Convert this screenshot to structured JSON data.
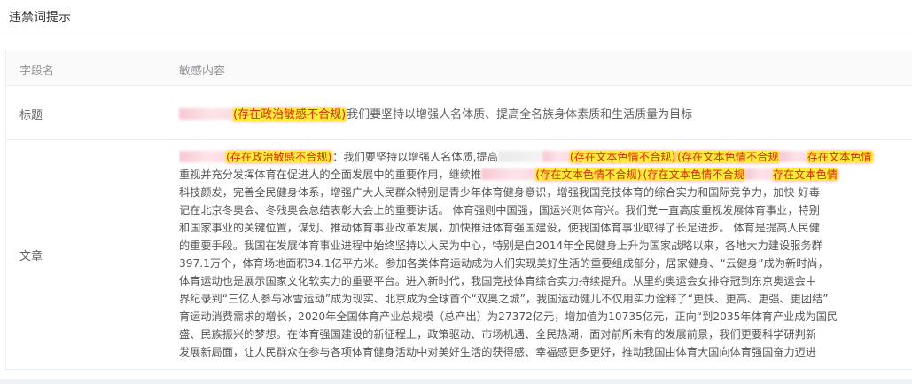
{
  "header": {
    "title": "违禁词提示"
  },
  "table": {
    "col_field": "字段名",
    "col_content": "敏感内容",
    "row_title": {
      "field": "标题",
      "flag": "(存在政治敏感不合规)",
      "text": "我们要坚持以增强人名体质、提高全名族身体素质和生活质量为目标"
    },
    "row_article": {
      "field": "文章",
      "line1_flag": "(存在政治敏感不合规)",
      "line1_text": "：我们要坚持以增强人名体质,提高",
      "line1_flag2": "(存在文本色情不合规)",
      "line1_flag3": "(存在文本色情不合规",
      "line1_flag4": "存在文本色情",
      "line2_text": "重视并充分发挥体育在促进人的全面发展中的重要作用，继续推",
      "line2_flag1": "(存在文本色情不合规)",
      "line2_flag2": "(存在文本色情不合规",
      "line2_flag3": "存在文本色情",
      "line3": "科技颜发，完善全民健身体系，增强广大人民群众特别是青少年体育健身意识，增强我国竞技体育的综合实力和国际竞争力，加快  好毒",
      "line4": "记在北京冬奥会、冬残奥会总结表彰大会上的重要讲话。 体育强则中国强，国运兴则体育兴。我们党一直高度重视发展体育事业，特别",
      "line5": "和国家事业的关键位置，谋划、推动体育事业改革发展，加快推进体育强国建设，使我国体育事业取得了长足进步。 体育是提高人民健",
      "line6": "的重要手段。我国在发展体育事业进程中始终坚持以人民为中心，特别是自2014年全民健身上升为国家战略以来，各地大力建设服务群",
      "line7": "397.1万个，体育场地面积34.1亿平方米。参加各类体育运动成为人们实现美好生活的重要组成部分，居家健身、“云健身”成为新时尚，",
      "line8": "体育运动也是展示国家文化软实力的重要平台。进入新时代，我国竞技体育综合实力持续提升。从里约奥运会女排夺冠到东京奥运会中",
      "line9": "界纪录到“三亿人参与冰雪运动”成为现实、北京成为全球首个“双奥之城”，我国运动健儿不仅用实力诠释了“更快、更高、更强、更团结”",
      "line10": "育运动消费需求的增长，2020年全国体育产业总规模（总产出）为27372亿元，增加值为10735亿元，正向“到2035年体育产业成为国民",
      "line11": "盛、民族振兴的梦想。在体育强国建设的新征程上，政策驱动、市场机遇、全民热潮，面对前所未有的发展前景，我们更要科学研判新",
      "line12": "发展新局面，让人民群众在参与各项体育健身活动中对美好生活的获得感、幸福感更多更好，推动我国由体育大国向体育强国奋力迈进"
    }
  }
}
